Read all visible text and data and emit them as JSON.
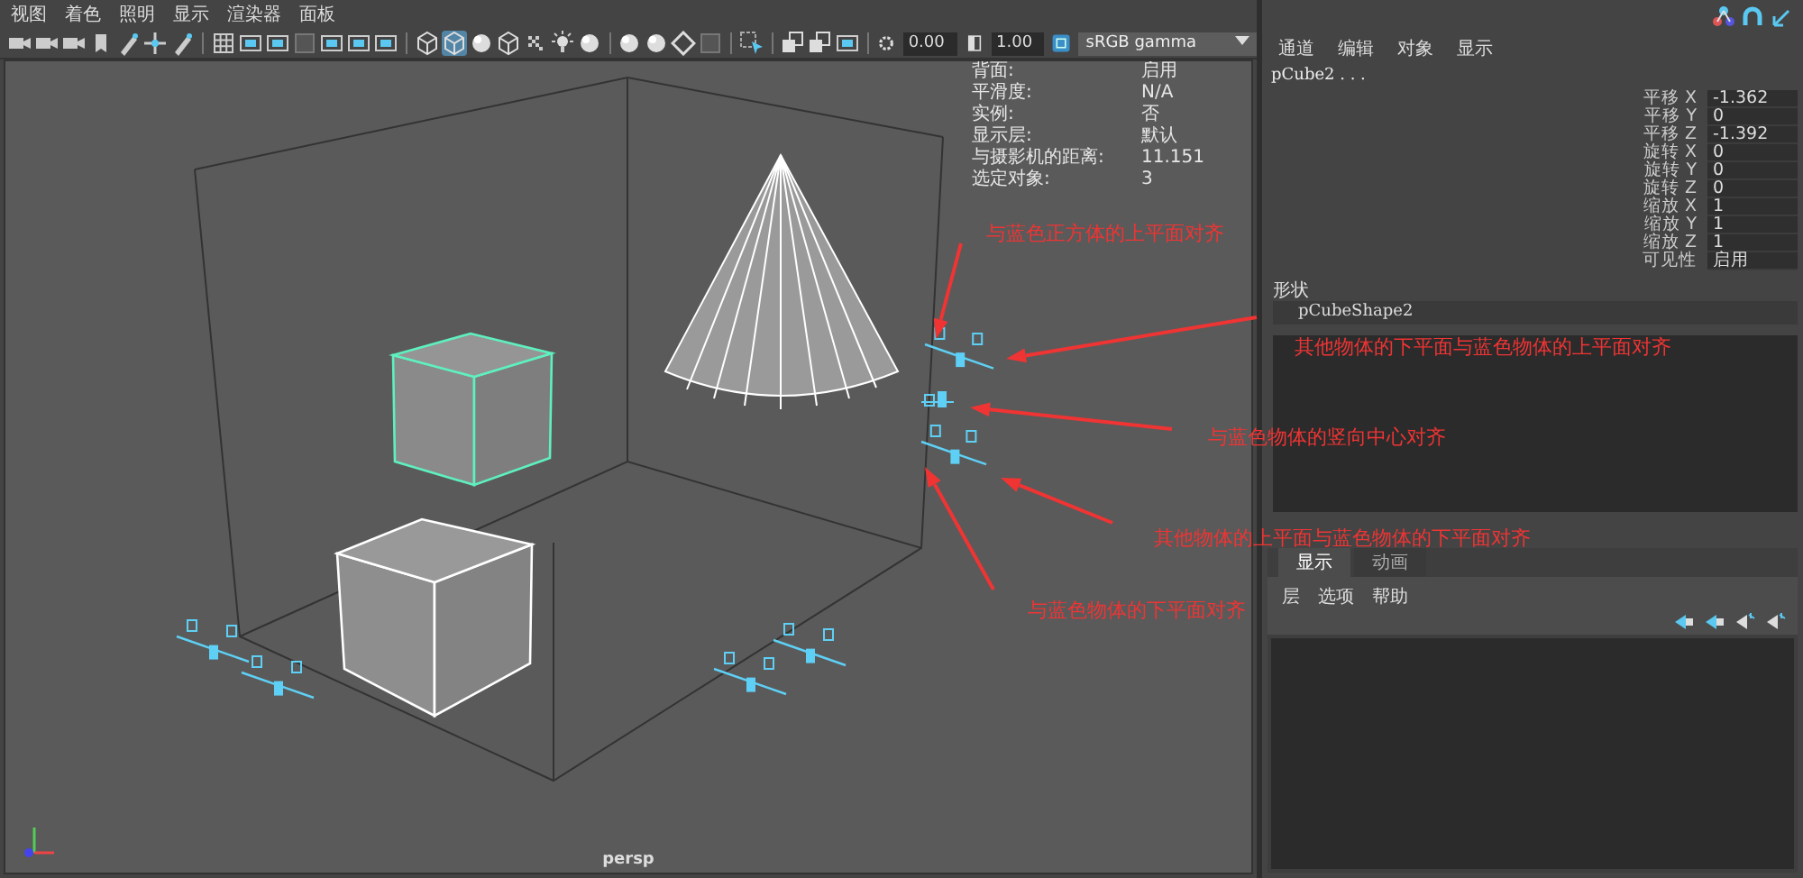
{
  "viewport": {
    "menu": [
      "视图",
      "着色",
      "照明",
      "显示",
      "渲染器",
      "面板"
    ],
    "toolbar": {
      "buttons": [
        {
          "selected": false
        },
        {
          "selected": false
        },
        {
          "selected": false
        },
        {
          "selected": false
        },
        {
          "selected": false
        },
        {
          "selected": false
        },
        {
          "selected": false
        },
        {
          "selected": false
        },
        {
          "selected": false
        },
        {
          "selected": false
        },
        {
          "selected": false
        },
        {
          "selected": false
        },
        {
          "selected": false
        },
        {
          "selected": false
        },
        {
          "selected": false
        },
        {
          "selected": true
        },
        {
          "selected": false
        },
        {
          "selected": false
        },
        {
          "selected": false
        },
        {
          "selected": false
        },
        {
          "selected": false
        },
        {
          "selected": false
        },
        {
          "selected": false
        },
        {
          "selected": false
        },
        {
          "selected": false
        },
        {
          "selected": false
        },
        {
          "selected": false
        },
        {
          "selected": false
        },
        {
          "selected": false
        }
      ],
      "exposure": "0.00",
      "gamma": "1.00",
      "color_space": "sRGB gamma"
    },
    "hud": [
      {
        "label": "背面:",
        "value": "启用"
      },
      {
        "label": "平滑度:",
        "value": "N/A"
      },
      {
        "label": "实例:",
        "value": "否"
      },
      {
        "label": "显示层:",
        "value": "默认"
      },
      {
        "label": "与摄影机的距离:",
        "value": "11.151"
      },
      {
        "label": "选定对象:",
        "value": "3"
      }
    ],
    "camera": "persp"
  },
  "channel_box": {
    "menu": [
      "通道",
      "编辑",
      "对象",
      "显示"
    ],
    "object": "pCube2 . . .",
    "channels": [
      {
        "label": "平移 X",
        "value": "-1.362"
      },
      {
        "label": "平移 Y",
        "value": "0"
      },
      {
        "label": "平移 Z",
        "value": "-1.392"
      },
      {
        "label": "旋转 X",
        "value": "0"
      },
      {
        "label": "旋转 Y",
        "value": "0"
      },
      {
        "label": "旋转 Z",
        "value": "0"
      },
      {
        "label": "缩放 X",
        "value": "1"
      },
      {
        "label": "缩放 Y",
        "value": "1"
      },
      {
        "label": "缩放 Z",
        "value": "1"
      },
      {
        "label": "可见性",
        "value": "启用"
      }
    ],
    "shapes_heading": "形状",
    "shape": "pCubeShape2"
  },
  "layer_editor": {
    "tabs": [
      {
        "label": "显示",
        "selected": true
      },
      {
        "label": "动画",
        "selected": false
      }
    ],
    "menu": [
      "层",
      "选项",
      "帮助"
    ]
  },
  "annotations": [
    "与蓝色正方体的上平面对齐",
    "其他物体的下平面与蓝色物体的上平面对齐",
    "与蓝色物体的竖向中心对齐",
    "其他物体的上平面与蓝色物体的下平面对齐",
    "与蓝色物体的下平面对齐"
  ]
}
